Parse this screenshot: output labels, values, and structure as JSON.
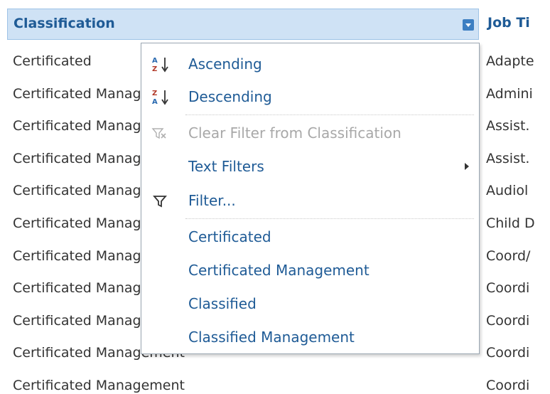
{
  "header": {
    "classification": "Classification",
    "job_title": "Job Ti"
  },
  "rows": [
    {
      "classification": "Certificated",
      "job": "Adapte"
    },
    {
      "classification": "Certificated Management",
      "job": "Admini"
    },
    {
      "classification": "Certificated Management",
      "job": "Assist."
    },
    {
      "classification": "Certificated Management",
      "job": "Assist."
    },
    {
      "classification": "Certificated Management",
      "job": "Audiol"
    },
    {
      "classification": "Certificated Management",
      "job": "Child D"
    },
    {
      "classification": "Certificated Management",
      "job": "Coord/"
    },
    {
      "classification": "Certificated Management",
      "job": "Coordi"
    },
    {
      "classification": "Certificated Management",
      "job": "Coordi"
    },
    {
      "classification": "Certificated Management",
      "job": "Coordi"
    },
    {
      "classification": "Certificated Management",
      "job": "Coordi"
    }
  ],
  "menu": {
    "ascending": "Ascending",
    "descending": "Descending",
    "clear_filter": "Clear Filter from Classification",
    "text_filters": "Text Filters",
    "filter": "Filter...",
    "values": [
      "Certificated",
      "Certificated Management",
      "Classified",
      "Classified Management"
    ]
  },
  "colors": {
    "header_bg": "#cfe2f5",
    "accent_blue": "#1f5b96",
    "disabled_gray": "#a8a8a8"
  },
  "icons": {
    "ascending": "sort-a-z-icon",
    "descending": "sort-z-a-icon",
    "clear_filter": "clear-filter-icon",
    "filter": "filter-funnel-icon"
  }
}
